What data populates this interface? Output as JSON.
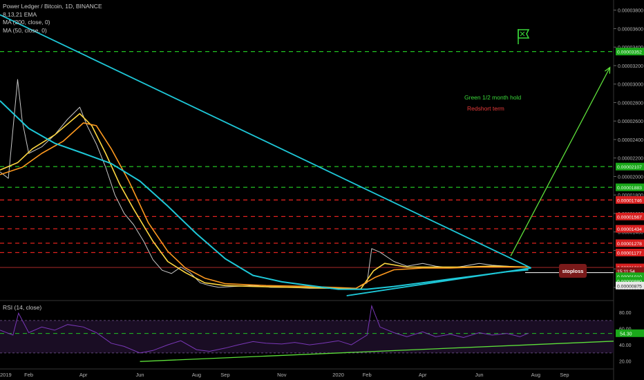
{
  "header": {
    "symbol_line": "Power Ledger / Bitcoin, 1D, BINANCE",
    "value_line": "8,13,21 EMA",
    "ma_line_1": "MA (200, close, 0)",
    "ma_line_2": "MA (50, close, 0)"
  },
  "annotations": {
    "green_text": "Green 1/2 month hold",
    "red_text": "Redshort term",
    "stoploss": "stoploss",
    "flag_icon": "flag-icon"
  },
  "colors": {
    "background": "#000000",
    "green_level": "#22c322",
    "red_level": "#e0221e",
    "trendline": "#1ec8d8",
    "ema_fast": "#ffd740",
    "ema_slow": "#ff9a1f",
    "ma_long": "#1ec8d8",
    "rsi_line": "#7a38b8",
    "arrow": "#5de03a",
    "stoploss_bg": "#7a1a1a",
    "axis_text": "#b4b4b4"
  },
  "chart_data": [
    {
      "type": "line",
      "pane": "price",
      "x_ticks": [
        "2019",
        "Feb",
        "Apr",
        "Jun",
        "Aug",
        "Sep",
        "Nov",
        "2020",
        "Feb",
        "Apr",
        "Jun",
        "Aug",
        "Sep"
      ],
      "x_tick_dates": [
        "2019-01-01",
        "2019-02-01",
        "2019-04-01",
        "2019-06-01",
        "2019-08-01",
        "2019-09-01",
        "2019-11-01",
        "2020-01-01",
        "2020-02-01",
        "2020-04-01",
        "2020-06-01",
        "2020-08-01",
        "2020-09-01"
      ],
      "xlim": [
        "2019-01-01",
        "2020-10-24"
      ],
      "y_ticks": [
        "0.00003800",
        "0.00003600",
        "0.00003400",
        "0.00003200",
        "0.00003000",
        "0.00002800",
        "0.00002600",
        "0.00002400",
        "0.00002200",
        "0.00002000",
        "0.00001800",
        "0.00001600",
        "0.00001400",
        "0.00001200",
        "0.00001000",
        "0.00000800"
      ],
      "ylim": [
        6.8e-06,
        3.88e-05
      ],
      "levels_green": [
        {
          "label": "0.00003352",
          "value": 3.352e-05
        },
        {
          "label": "0.00002107",
          "value": 2.107e-05
        },
        {
          "label": "0.00001883",
          "value": 1.883e-05
        }
      ],
      "levels_red": [
        {
          "label": "0.00001746",
          "value": 1.746e-05
        },
        {
          "label": "0.00001567",
          "value": 1.567e-05
        },
        {
          "label": "0.00001434",
          "value": 1.434e-05
        },
        {
          "label": "0.00001278",
          "value": 1.278e-05
        },
        {
          "label": "0.00001177",
          "value": 1.177e-05
        }
      ],
      "price_tags": [
        {
          "label": "0.00001016",
          "value": 1.016e-05,
          "kind": "last"
        },
        {
          "label": "15:11:54",
          "value": 9.78e-06,
          "kind": "timer"
        },
        {
          "label": "0.00001010",
          "value": 9.2e-06,
          "kind": "green"
        },
        {
          "label": "0.00000980",
          "value": 8.7e-06,
          "kind": "green"
        },
        {
          "label": "0.00000875",
          "value": 8.2e-06,
          "kind": "white"
        }
      ],
      "stoploss_level": 9.6e-06,
      "series": [
        {
          "role": "price",
          "x": [
            "2019-01-01",
            "2019-01-10",
            "2019-01-20",
            "2019-01-25",
            "2019-02-01",
            "2019-02-15",
            "2019-03-01",
            "2019-03-15",
            "2019-03-28",
            "2019-04-05",
            "2019-04-15",
            "2019-04-25",
            "2019-05-05",
            "2019-05-15",
            "2019-05-25",
            "2019-06-05",
            "2019-06-15",
            "2019-06-25",
            "2019-07-05",
            "2019-07-15",
            "2019-07-25",
            "2019-08-05",
            "2019-08-15",
            "2019-08-25",
            "2019-09-10",
            "2019-10-01",
            "2019-10-20",
            "2019-11-10",
            "2019-12-01",
            "2019-12-20",
            "2020-01-05",
            "2020-01-20",
            "2020-02-01",
            "2020-02-06",
            "2020-02-15",
            "2020-03-01",
            "2020-03-15",
            "2020-04-01",
            "2020-04-15",
            "2020-05-01",
            "2020-05-15",
            "2020-06-01",
            "2020-06-15",
            "2020-07-01",
            "2020-07-15",
            "2020-07-24"
          ],
          "y": [
            2.05e-05,
            1.98e-05,
            3.05e-05,
            2.6e-05,
            2.25e-05,
            2.32e-05,
            2.45e-05,
            2.62e-05,
            2.75e-05,
            2.55e-05,
            2.35e-05,
            2.1e-05,
            1.8e-05,
            1.6e-05,
            1.48e-05,
            1.3e-05,
            1.1e-05,
            9.85e-06,
            9.5e-06,
            1.02e-05,
            9.6e-06,
            8.5e-06,
            8.2e-06,
            8e-06,
            8.1e-06,
            8.2e-06,
            8e-06,
            8e-06,
            7.9e-06,
            7.9e-06,
            7.8e-06,
            7.9e-06,
            8.5e-06,
            1.22e-05,
            1.18e-05,
            1.08e-05,
            1.03e-05,
            1.06e-05,
            1.03e-05,
            1.01e-05,
            1.03e-05,
            1.06e-05,
            1.04e-05,
            1.03e-05,
            1.02e-05,
            1.02e-05
          ]
        },
        {
          "role": "ema",
          "x": [
            "2019-01-01",
            "2019-01-20",
            "2019-02-05",
            "2019-03-01",
            "2019-03-28",
            "2019-04-10",
            "2019-04-25",
            "2019-05-10",
            "2019-05-25",
            "2019-06-15",
            "2019-07-01",
            "2019-07-20",
            "2019-08-10",
            "2019-09-01",
            "2019-10-01",
            "2019-11-15",
            "2020-01-01",
            "2020-01-25",
            "2020-02-08",
            "2020-02-20",
            "2020-03-15",
            "2020-04-15",
            "2020-05-15",
            "2020-06-15",
            "2020-07-24"
          ],
          "y": [
            2.07e-05,
            2.15e-05,
            2.3e-05,
            2.45e-05,
            2.68e-05,
            2.55e-05,
            2.25e-05,
            1.92e-05,
            1.65e-05,
            1.3e-05,
            1.08e-05,
            9.6e-06,
            8.5e-06,
            8.2e-06,
            8.1e-06,
            8e-06,
            7.9e-06,
            7.8e-06,
            9.8e-06,
            1.06e-05,
            1.02e-05,
            1.02e-05,
            1.02e-05,
            1.03e-05,
            1.02e-05
          ]
        },
        {
          "role": "ema",
          "x": [
            "2019-01-01",
            "2019-01-25",
            "2019-02-15",
            "2019-03-10",
            "2019-04-01",
            "2019-04-15",
            "2019-05-01",
            "2019-05-20",
            "2019-06-10",
            "2019-07-01",
            "2019-07-20",
            "2019-08-10",
            "2019-09-01",
            "2019-10-15",
            "2019-12-01",
            "2020-01-20",
            "2020-02-10",
            "2020-03-01",
            "2020-04-01",
            "2020-05-01",
            "2020-06-01",
            "2020-07-24"
          ],
          "y": [
            2.02e-05,
            2.1e-05,
            2.25e-05,
            2.38e-05,
            2.58e-05,
            2.55e-05,
            2.3e-05,
            1.95e-05,
            1.5e-05,
            1.19e-05,
            1.01e-05,
            9e-06,
            8.4e-06,
            8.2e-06,
            8.1e-06,
            7.9e-06,
            9.1e-06,
            9.9e-06,
            1.01e-05,
            1.01e-05,
            1.02e-05,
            1.02e-05
          ]
        },
        {
          "role": "ma",
          "x": [
            "2019-01-01",
            "2019-02-01",
            "2019-03-01",
            "2019-04-01",
            "2019-05-01",
            "2019-06-01",
            "2019-07-01",
            "2019-08-01",
            "2019-09-01",
            "2019-10-01",
            "2019-11-01",
            "2019-12-01",
            "2020-01-01",
            "2020-02-01",
            "2020-03-01",
            "2020-04-01",
            "2020-05-01",
            "2020-06-01",
            "2020-07-01",
            "2020-07-24"
          ],
          "y": [
            2.82e-05,
            2.52e-05,
            2.36e-05,
            2.25e-05,
            2.14e-05,
            1.95e-05,
            1.68e-05,
            1.38e-05,
            1.11e-05,
            9.3e-06,
            8.6e-06,
            8.2e-06,
            7.8e-06,
            7.8e-06,
            8.1e-06,
            8.5e-06,
            8.9e-06,
            9.3e-06,
            9.7e-06,
            9.9e-06
          ]
        }
      ],
      "trendlines": [
        {
          "role": "descending",
          "x": [
            "2019-01-01",
            "2020-07-27"
          ],
          "y": [
            3.75e-05,
            1.01e-05
          ]
        },
        {
          "role": "ascending",
          "x": [
            "2020-01-10",
            "2020-07-27"
          ],
          "y": [
            7.1e-06,
            1.01e-05
          ]
        },
        {
          "role": "target-arrow",
          "x": [
            "2020-07-05",
            "2020-10-20"
          ],
          "y": [
            1.14e-05,
            3.18e-05
          ]
        }
      ]
    },
    {
      "type": "line",
      "pane": "rsi",
      "title": "RSI (14, close)",
      "ylim": [
        12,
        92
      ],
      "y_ticks": [
        "80.00",
        "60.00",
        "40.00",
        "20.00"
      ],
      "bands": [
        70,
        30
      ],
      "level_lines": [
        54
      ],
      "value_tag": "54.30",
      "trendline": {
        "x": [
          "2019-06-01",
          "2020-10-24"
        ],
        "y": [
          19.5,
          44.5
        ]
      },
      "series": [
        {
          "name": "RSI",
          "x": [
            "2019-01-01",
            "2019-01-15",
            "2019-01-21",
            "2019-02-01",
            "2019-02-15",
            "2019-03-01",
            "2019-03-15",
            "2019-04-01",
            "2019-04-15",
            "2019-05-01",
            "2019-05-15",
            "2019-06-01",
            "2019-06-15",
            "2019-07-01",
            "2019-07-15",
            "2019-08-01",
            "2019-08-15",
            "2019-09-01",
            "2019-09-15",
            "2019-10-01",
            "2019-10-15",
            "2019-11-01",
            "2019-11-15",
            "2019-12-01",
            "2019-12-15",
            "2020-01-01",
            "2020-01-15",
            "2020-02-01",
            "2020-02-06",
            "2020-02-15",
            "2020-03-01",
            "2020-03-15",
            "2020-04-01",
            "2020-04-15",
            "2020-05-01",
            "2020-05-15",
            "2020-06-01",
            "2020-06-15",
            "2020-07-01",
            "2020-07-15",
            "2020-07-24"
          ],
          "y": [
            58,
            52,
            79,
            55,
            62,
            58,
            65,
            62,
            55,
            42,
            38,
            30,
            33,
            40,
            45,
            34,
            32,
            36,
            40,
            44,
            42,
            41,
            43,
            40,
            42,
            45,
            40,
            52,
            88,
            62,
            55,
            50,
            56,
            50,
            53,
            49,
            55,
            52,
            54,
            50,
            54.3
          ]
        }
      ]
    }
  ]
}
